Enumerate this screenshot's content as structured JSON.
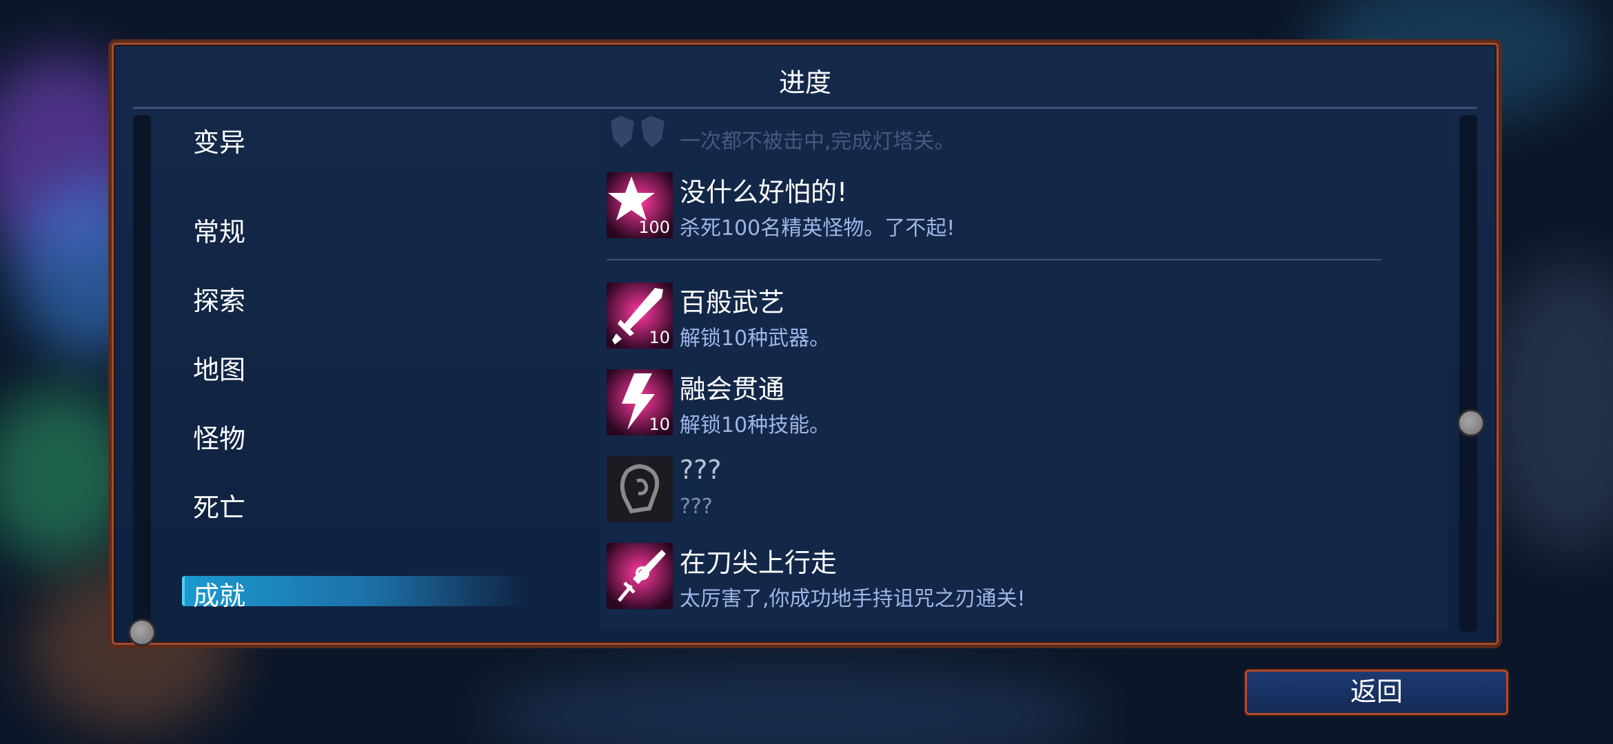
{
  "panel": {
    "title": "进度"
  },
  "sidebar": {
    "items": [
      {
        "label": "变异"
      },
      {
        "label": "常规"
      },
      {
        "label": "探索"
      },
      {
        "label": "地图"
      },
      {
        "label": "怪物"
      },
      {
        "label": "死亡"
      },
      {
        "label": "成就",
        "active": true
      }
    ]
  },
  "achievements": [
    {
      "title": "",
      "description": "一次都不被击中,完成灯塔关。",
      "icon": "mask-icon",
      "state": "faded"
    },
    {
      "title": "没什么好怕的!",
      "description": "杀死100名精英怪物。了不起!",
      "icon": "star-icon",
      "counter": "100"
    },
    {
      "title": "百般武艺",
      "description": "解锁10种武器。",
      "icon": "sword-icon",
      "counter": "10"
    },
    {
      "title": "融会贯通",
      "description": "解锁10种技能。",
      "icon": "lightning-icon",
      "counter": "10"
    },
    {
      "title": "???",
      "description": "???",
      "icon": "locked-head-icon",
      "state": "locked"
    },
    {
      "title": "在刀尖上行走",
      "description": "太厉害了,你成功地手持诅咒之刃通关!",
      "icon": "cursed-blade-icon"
    }
  ],
  "footer": {
    "back_label": "返回"
  },
  "colors": {
    "accent": "#e0156e",
    "frame": "#a34d33",
    "active_tab": "#1b9ad0",
    "description": "#9fb6e6"
  }
}
